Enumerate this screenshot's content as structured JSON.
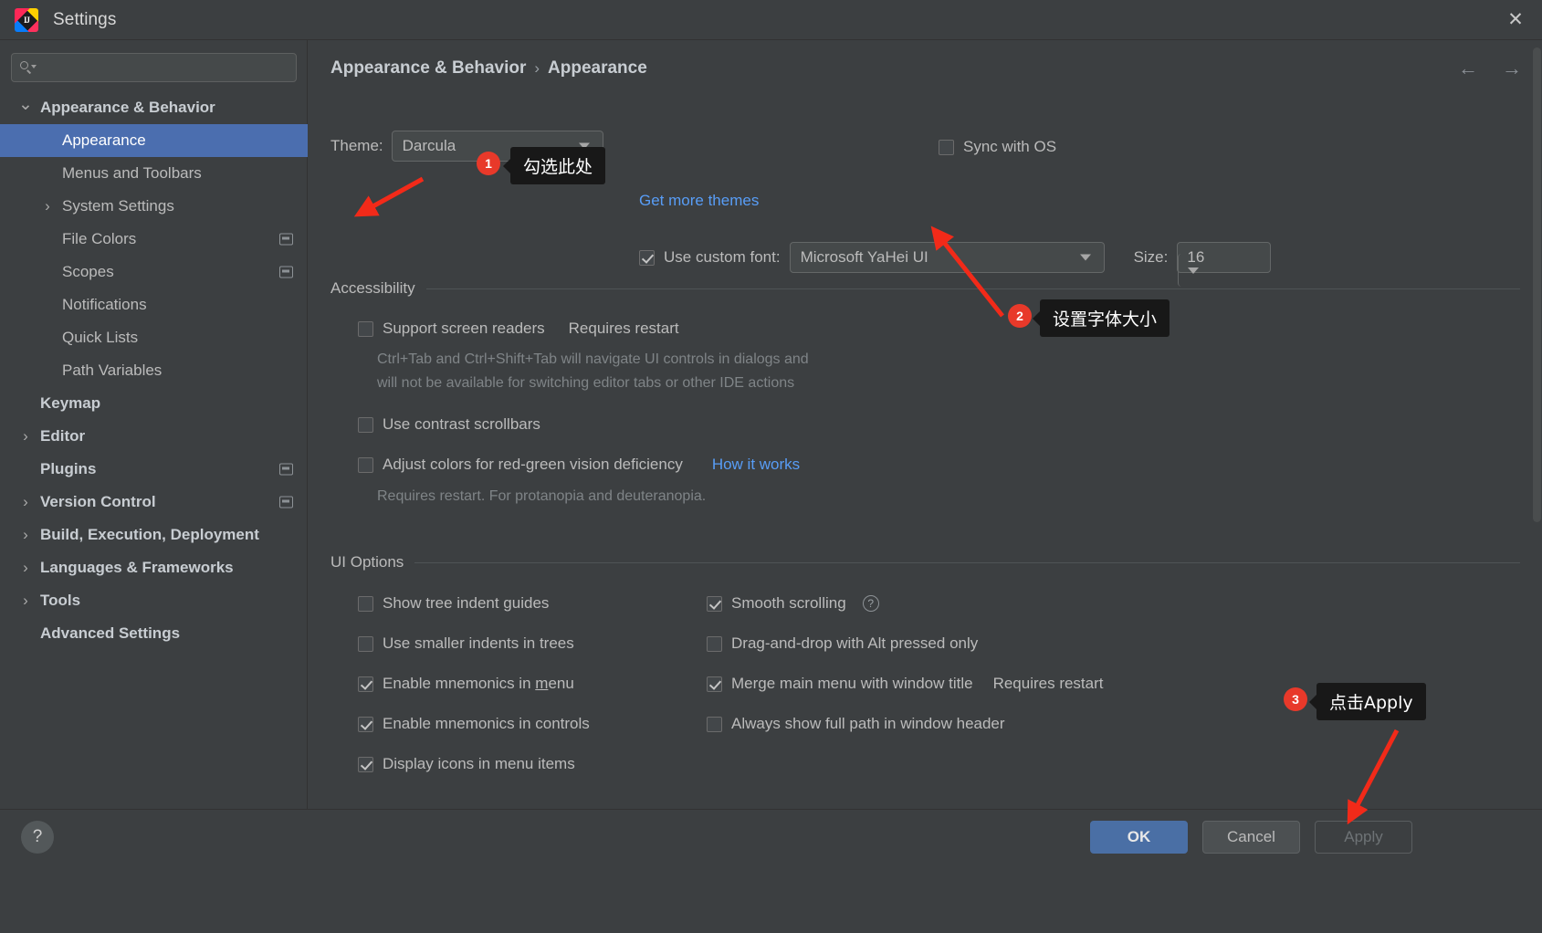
{
  "window": {
    "title": "Settings",
    "app_icon": "intellij-idea-icon",
    "close_icon": "close-icon"
  },
  "search": {
    "value": "",
    "placeholder": "",
    "icon": "search-icon"
  },
  "sidebar": {
    "items": [
      {
        "label": "Appearance & Behavior",
        "level": 0,
        "twisty": "chevron-down-icon",
        "bold": true,
        "selected": false,
        "badge": false
      },
      {
        "label": "Appearance",
        "level": 1,
        "twisty": "",
        "bold": false,
        "selected": true,
        "badge": false
      },
      {
        "label": "Menus and Toolbars",
        "level": 1,
        "twisty": "",
        "bold": false,
        "selected": false,
        "badge": false
      },
      {
        "label": "System Settings",
        "level": 1,
        "twisty": "chevron-right-icon",
        "bold": false,
        "selected": false,
        "badge": false
      },
      {
        "label": "File Colors",
        "level": 1,
        "twisty": "",
        "bold": false,
        "selected": false,
        "badge": true
      },
      {
        "label": "Scopes",
        "level": 1,
        "twisty": "",
        "bold": false,
        "selected": false,
        "badge": true
      },
      {
        "label": "Notifications",
        "level": 1,
        "twisty": "",
        "bold": false,
        "selected": false,
        "badge": false
      },
      {
        "label": "Quick Lists",
        "level": 1,
        "twisty": "",
        "bold": false,
        "selected": false,
        "badge": false
      },
      {
        "label": "Path Variables",
        "level": 1,
        "twisty": "",
        "bold": false,
        "selected": false,
        "badge": false
      },
      {
        "label": "Keymap",
        "level": 0,
        "twisty": "",
        "bold": true,
        "selected": false,
        "badge": false
      },
      {
        "label": "Editor",
        "level": 0,
        "twisty": "chevron-right-icon",
        "bold": true,
        "selected": false,
        "badge": false
      },
      {
        "label": "Plugins",
        "level": 0,
        "twisty": "",
        "bold": true,
        "selected": false,
        "badge": true
      },
      {
        "label": "Version Control",
        "level": 0,
        "twisty": "chevron-right-icon",
        "bold": true,
        "selected": false,
        "badge": true
      },
      {
        "label": "Build, Execution, Deployment",
        "level": 0,
        "twisty": "chevron-right-icon",
        "bold": true,
        "selected": false,
        "badge": false
      },
      {
        "label": "Languages & Frameworks",
        "level": 0,
        "twisty": "chevron-right-icon",
        "bold": true,
        "selected": false,
        "badge": false
      },
      {
        "label": "Tools",
        "level": 0,
        "twisty": "chevron-right-icon",
        "bold": true,
        "selected": false,
        "badge": false
      },
      {
        "label": "Advanced Settings",
        "level": 0,
        "twisty": "",
        "bold": true,
        "selected": false,
        "badge": false
      }
    ]
  },
  "main": {
    "breadcrumb": {
      "root": "Appearance & Behavior",
      "separator": "›",
      "leaf": "Appearance"
    },
    "nav": {
      "back_icon": "arrow-left-icon",
      "forward_icon": "arrow-right-icon"
    },
    "theme": {
      "label": "Theme:",
      "value": "Darcula",
      "sync_label": "Sync with OS",
      "sync_checked": false,
      "get_more_themes": "Get more themes"
    },
    "custom_font": {
      "label": "Use custom font:",
      "checked": true,
      "value": "Microsoft YaHei UI",
      "size_label": "Size:",
      "size_value": "16"
    },
    "accessibility": {
      "title": "Accessibility",
      "screen_readers": {
        "label": "Support screen readers",
        "note": "Requires restart",
        "checked": false
      },
      "screen_readers_desc_line1": "Ctrl+Tab and Ctrl+Shift+Tab will navigate UI controls in dialogs and",
      "screen_readers_desc_line2": "will not be available for switching editor tabs or other IDE actions",
      "contrast_scrollbars": {
        "label": "Use contrast scrollbars",
        "checked": false
      },
      "red_green": {
        "label": "Adjust colors for red-green vision deficiency",
        "link": "How it works",
        "checked": false
      },
      "red_green_desc": "Requires restart. For protanopia and deuteranopia."
    },
    "ui_options": {
      "title": "UI Options",
      "left": [
        {
          "label": "Show tree indent guides",
          "checked": false
        },
        {
          "label": "Use smaller indents in trees",
          "checked": false
        },
        {
          "label": "Enable mnemonics in menu",
          "checked": true,
          "mnemonic": "m"
        },
        {
          "label": "Enable mnemonics in controls",
          "checked": true
        },
        {
          "label": "Display icons in menu items",
          "checked": true
        }
      ],
      "right": [
        {
          "label": "Smooth scrolling",
          "checked": true,
          "help": "?"
        },
        {
          "label": "Drag-and-drop with Alt pressed only",
          "checked": false
        },
        {
          "label": "Merge main menu with window title",
          "note": "Requires restart",
          "checked": true
        },
        {
          "label": "Always show full path in window header",
          "checked": false
        }
      ]
    }
  },
  "footer": {
    "help_label": "?",
    "ok": "OK",
    "cancel": "Cancel",
    "apply": "Apply"
  },
  "annotations": [
    {
      "number": "1",
      "tip": "勾选此处"
    },
    {
      "number": "2",
      "tip": "设置字体大小"
    },
    {
      "number": "3",
      "tip": "点击Apply"
    }
  ],
  "colors": {
    "background": "#3c3f41",
    "selection": "#4b6eaf",
    "link": "#589df6",
    "annotation": "#e8392a",
    "primary_button": "#4a6fa5"
  }
}
